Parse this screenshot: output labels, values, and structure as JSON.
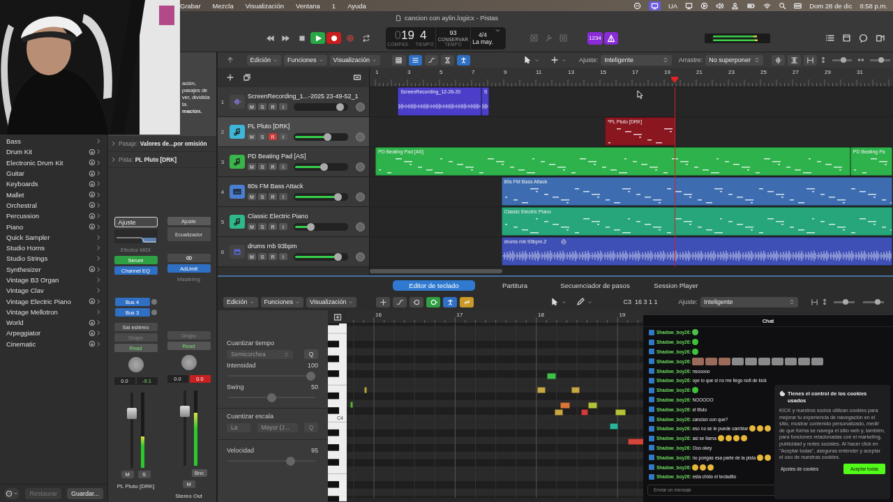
{
  "menu_bar": {
    "items": [
      "Grabar",
      "Mezcla",
      "Visualización",
      "Ventana",
      "1",
      "Ayuda"
    ],
    "input_source": "UA",
    "date": "Dom 28 de dic",
    "time": "8:58 p.m."
  },
  "window": {
    "title": "cancion con aylin.logicx - Pistas"
  },
  "transport": [
    {
      "kind": "rewind",
      "on": false
    },
    {
      "kind": "forward",
      "on": false
    },
    {
      "kind": "stop",
      "on": false
    },
    {
      "kind": "play",
      "on": true
    },
    {
      "kind": "record",
      "on": true
    },
    {
      "kind": "capture",
      "on": false
    },
    {
      "kind": "cycle",
      "on": false
    }
  ],
  "lcd": {
    "bar_lead": "0",
    "bar": "19",
    "beat": "4",
    "bar_label": "COMPÁS",
    "beat_label": "TIEMPO",
    "tempo": "93",
    "tempo_mode": "CONSERVAR",
    "tempo_label": "TEMPO",
    "signature": "4/4",
    "key": "La may."
  },
  "count_in": "1234",
  "library": {
    "categories": [
      {
        "label": "Bass",
        "download": false
      },
      {
        "label": "Drum Kit",
        "download": true
      },
      {
        "label": "Electronic Drum Kit",
        "download": true
      },
      {
        "label": "Guitar",
        "download": true
      },
      {
        "label": "Keyboards",
        "download": true
      },
      {
        "label": "Mallet",
        "download": true
      },
      {
        "label": "Orchestral",
        "download": true
      },
      {
        "label": "Percussion",
        "download": true
      },
      {
        "label": "Piano",
        "download": true
      },
      {
        "label": "Quick Sampler",
        "download": false
      },
      {
        "label": "Studio Horns",
        "download": false
      },
      {
        "label": "Studio Strings",
        "download": false
      },
      {
        "label": "Synthesizer",
        "download": true
      },
      {
        "label": "Vintage B3 Organ",
        "download": false
      },
      {
        "label": "Vintage Clav",
        "download": false
      },
      {
        "label": "Vintage Electric Piano",
        "download": true
      },
      {
        "label": "Vintage Mellotron",
        "download": false
      },
      {
        "label": "World",
        "download": true
      },
      {
        "label": "Arpeggiator",
        "download": true
      },
      {
        "label": "Cinematic",
        "download": true
      }
    ],
    "restore": {
      "label": "Restaurar",
      "disabled": true
    },
    "save": {
      "label": "Guardar...",
      "disabled": false
    }
  },
  "inspector": {
    "help_lines": [
      {
        "text": "ación,",
        "bold": false
      },
      {
        "text": "pasajes de",
        "bold": false
      },
      {
        "text": "ver, dividida",
        "bold": false
      },
      {
        "text": "ta.",
        "bold": false
      },
      {
        "text": "mación.",
        "bold": true
      }
    ],
    "region_row": {
      "label": "Pasaje:",
      "value": "Valores de...por omisión"
    },
    "track_row": {
      "label": "Pista:",
      "value": "PL Pluto [DRK]"
    },
    "strips": [
      {
        "kind": "instrument",
        "setting": "Ajuste",
        "focused": true,
        "midi_fx": "Efectos MIDI",
        "instrument": "Serum",
        "inserts": [
          {
            "label": "Channel EQ",
            "active": true
          }
        ],
        "sends": [
          "Bus 4",
          "Bus 3"
        ],
        "output": "Sal estéreo",
        "group": "Grupo",
        "automation": "Read",
        "volume": "0.0",
        "peak": "-9.1",
        "clip": false,
        "fader": {
          "level": 0.72
        },
        "meter": {
          "level": 0.42
        },
        "buttons": [
          "M",
          "S"
        ],
        "name": "PL Pluto [DRK]"
      },
      {
        "kind": "output",
        "setting": "Ajuste",
        "focused": false,
        "eq_label": "Ecualizador",
        "inserts": [
          {
            "label": "AdLimit",
            "active": true
          },
          {
            "label": "Mastering",
            "active": false
          }
        ],
        "group": "Grupo",
        "automation": "Read",
        "volume": "0.0",
        "peak": "0.0",
        "clip": true,
        "fader": {
          "level": 0.72
        },
        "meter": {
          "level": 0.7
        },
        "bounce": "Bnc",
        "buttons": [
          "M"
        ],
        "name": "Stereo Out"
      }
    ]
  },
  "tracks_toolbar": {
    "menus": [
      "Edición",
      "Funciones",
      "Visualización"
    ],
    "snap_label": "Ajuste:",
    "snap": "Inteligente",
    "drag_label": "Arrastre:",
    "drag": "No superponer",
    "zoom_sliders": [
      {
        "level": 0.6
      },
      {
        "level": 0.55
      }
    ]
  },
  "ruler": [
    "1",
    "3",
    "5",
    "7",
    "9",
    "11",
    "13",
    "15",
    "17",
    "19",
    "21",
    "23",
    "25",
    "27",
    "29",
    "31"
  ],
  "tracks": [
    {
      "number": "1",
      "name": "ScreenRecording_1...-2025 23-49-52_1",
      "kind": "audio",
      "buttons": [
        "M",
        "S",
        "R",
        "I"
      ],
      "selected": false,
      "armed": false,
      "signal": false,
      "level": 0.86,
      "regions": [
        {
          "name": "ScreenRecording_12-26-20",
          "kind": "audio",
          "color": "#4b3fc9"
        },
        {
          "name": "S",
          "kind": "audio",
          "color": "#4b3fc9"
        }
      ]
    },
    {
      "number": "2",
      "name": "PL Pluto [DRK]",
      "kind": "instrument",
      "buttons": [
        "M",
        "S",
        "R",
        "I"
      ],
      "selected": true,
      "armed": true,
      "signal": true,
      "level": 0.62,
      "regions": [
        {
          "name": "*PL Pluto [DRK]",
          "kind": "midi",
          "color": "#8a1620"
        }
      ]
    },
    {
      "number": "3",
      "name": "PD Beating Pad [AS]",
      "kind": "instrument",
      "buttons": [
        "M",
        "S",
        "R",
        "I"
      ],
      "selected": false,
      "armed": false,
      "signal": true,
      "level": 0.55,
      "regions": [
        {
          "name": "PD Beating Pad [AS]",
          "kind": "midi",
          "color": "#2eb24b"
        },
        {
          "name": "PD Beating Pa",
          "kind": "midi",
          "color": "#2eb24b"
        }
      ]
    },
    {
      "number": "4",
      "name": "80s FM Bass Attack",
      "kind": "synth",
      "buttons": [
        "M",
        "S",
        "R",
        "I"
      ],
      "selected": false,
      "armed": false,
      "signal": true,
      "level": 0.82,
      "regions": [
        {
          "name": "80s FM Bass Attack",
          "kind": "midi",
          "color": "#3d6db0"
        }
      ]
    },
    {
      "number": "5",
      "name": "Classic Electric Piano",
      "kind": "instrument",
      "buttons": [
        "M",
        "S",
        "R",
        "I"
      ],
      "selected": false,
      "armed": false,
      "signal": true,
      "level": 0.3,
      "regions": [
        {
          "name": "Classic Electric Piano",
          "kind": "midi",
          "color": "#27a57b"
        }
      ]
    },
    {
      "number": "6",
      "name": "drums rnb 93bpm",
      "kind": "drums",
      "buttons": [
        "M",
        "S",
        "R",
        "I"
      ],
      "selected": false,
      "armed": false,
      "signal": true,
      "level": 0.82,
      "regions": [
        {
          "name": "drums rnb 93bpm.2",
          "kind": "audio",
          "color": "#3e4fb6"
        }
      ]
    }
  ],
  "editor": {
    "tabs": [
      {
        "label": "Editor de teclado",
        "selected": true
      },
      {
        "label": "Partitura",
        "selected": false
      },
      {
        "label": "Secuenciador de pasos",
        "selected": false
      },
      {
        "label": "Session Player",
        "selected": false
      }
    ],
    "menus": [
      "Edición",
      "Funciones",
      "Visualización"
    ],
    "position": "C3  16 3 1 1",
    "snap_label": "Ajuste:",
    "snap": "Inteligente",
    "zoom_sliders": [
      {
        "level": 0.6
      },
      {
        "level": 0.75
      }
    ],
    "quantize": {
      "time_title": "Cuantizar tiempo",
      "time_value": "Semicorchea",
      "q": "Q",
      "strength_label": "Intensidad",
      "strength": "100",
      "strength_slider": {
        "level": 1
      },
      "swing_label": "Swing",
      "swing": "50",
      "swing_slider": {
        "level": 0.5
      },
      "scale_title": "Cuantizar escala",
      "scale_root": "La",
      "scale_mode": "Mayor (J...",
      "scale_q": "Q",
      "velocity_label": "Velocidad",
      "velocity": "95",
      "velocity_slider": {
        "level": 0.74
      }
    },
    "ruler": [
      "16",
      "17",
      "18",
      "19"
    ],
    "key_label": "C4",
    "notes": [
      {
        "color": "#3ec24a"
      },
      {
        "color": "#b7a93a"
      },
      {
        "color": "#5bb83a"
      },
      {
        "color": "#c8a745"
      },
      {
        "color": "#c8a745"
      },
      {
        "color": "#d9763a"
      },
      {
        "color": "#b5c23a"
      },
      {
        "color": "#c8a745"
      },
      {
        "color": "#d23b3b"
      },
      {
        "color": "#b5c23a"
      },
      {
        "color": "#2bb59a"
      },
      {
        "color": "#d2463b"
      }
    ]
  },
  "chat": {
    "title": "Chat",
    "messages": [
      {
        "user": "Shadow_boy26:",
        "emotes": [
          {
            "color": "#4cc24a"
          }
        ]
      },
      {
        "user": "Shadow_boy26:",
        "emotes": [
          {
            "color": "#3fc23a"
          }
        ]
      },
      {
        "user": "Shadow_boy26:",
        "emotes": [
          {
            "color": "#3fc23a"
          }
        ]
      },
      {
        "user": "Shadow_boy26:",
        "emotes": [
          {
            "color": "#9a6a5a"
          },
          {
            "color": "#9a6a5a"
          },
          {
            "color": "#9a6a5a"
          },
          {
            "color": "#8a8a8a"
          },
          {
            "color": "#8a8a8a"
          },
          {
            "color": "#8a8a8a"
          },
          {
            "color": "#8a8a8a"
          },
          {
            "color": "#8a8a8a"
          },
          {
            "color": "#8a8a8a"
          },
          {
            "color": "#8a8a8a"
          }
        ]
      },
      {
        "user": "Shadow_boy26:",
        "text": "nsooooo"
      },
      {
        "user": "Shadow_boy26:",
        "text": "oye lo que si no me llego noti de kick"
      },
      {
        "user": "Shadow_boy26:",
        "emotes": [
          {
            "color": "#3fc23a"
          }
        ]
      },
      {
        "user": "Shadow_boy26:",
        "text": "NOOOOO"
      },
      {
        "user": "Shadow_boy26:",
        "text": "el titulo"
      },
      {
        "user": "Shadow_boy26:",
        "text": "cancion con que?"
      },
      {
        "user": "Shadow_boy26:",
        "text": "eso no se le puede cambiar",
        "emotes": [
          {
            "color": "#e8b83a"
          },
          {
            "color": "#e8b83a"
          },
          {
            "color": "#e8b83a"
          }
        ]
      },
      {
        "user": "Shadow_boy26:",
        "text": "asi se llama",
        "emotes": [
          {
            "color": "#e8b83a"
          },
          {
            "color": "#e8b83a"
          },
          {
            "color": "#e8b83a"
          },
          {
            "color": "#e8b83a"
          }
        ]
      },
      {
        "user": "Shadow_boy26:",
        "text": "Ooo okey"
      },
      {
        "user": "Shadow_boy26:",
        "text": "no pongas esa parte de la pista",
        "emotes": [
          {
            "color": "#e8b83a"
          },
          {
            "color": "#e8b83a"
          }
        ]
      },
      {
        "user": "Shadow_boy26:",
        "emotes": [
          {
            "color": "#e8b83a"
          },
          {
            "color": "#e8b83a"
          },
          {
            "color": "#e8b83a"
          }
        ]
      },
      {
        "user": "Shadow_boy26:",
        "text": "esta chido el tecladito"
      }
    ],
    "placeholder": "Enviar un mensaje",
    "cookies": {
      "title": "Tienes el control de los cookies usados",
      "body": "KICK y nuestros socios utilizan cookies para mejorar tu experiencia de navegación en el sitio, mostrar contenido personalizado, medir de qué forma se navega el sitio web y, también, para funciones relacionadas con el marketing, publicidad y redes sociales. Al hacer click en \"Aceptar todas\", aseguras entender y aceptar el uso de nuestras cookies.",
      "settings": "Ajustes de cookies",
      "accept": "Aceptar todas"
    }
  }
}
